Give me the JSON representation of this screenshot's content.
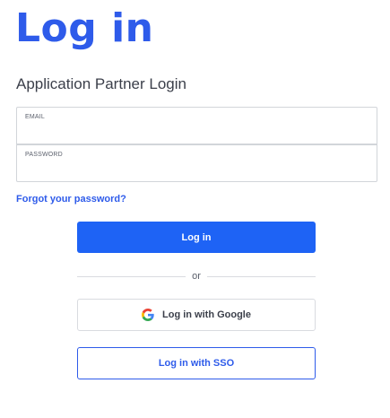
{
  "header": {
    "title": "Log in",
    "subtitle": "Application Partner Login"
  },
  "form": {
    "email": {
      "label": "EMAIL",
      "value": "",
      "placeholder": ""
    },
    "password": {
      "label": "PASSWORD",
      "value": "",
      "placeholder": ""
    },
    "forgot_link": "Forgot your password?",
    "login_button": "Log in",
    "divider_text": "or",
    "google_button": {
      "label": "Log in with Google",
      "icon": "google-icon"
    },
    "sso_button": "Log in with SSO"
  },
  "colors": {
    "brand": "#2e5bea",
    "primary_button": "#1e63f5",
    "border": "#d2d5da",
    "text": "#3b3f4a"
  }
}
